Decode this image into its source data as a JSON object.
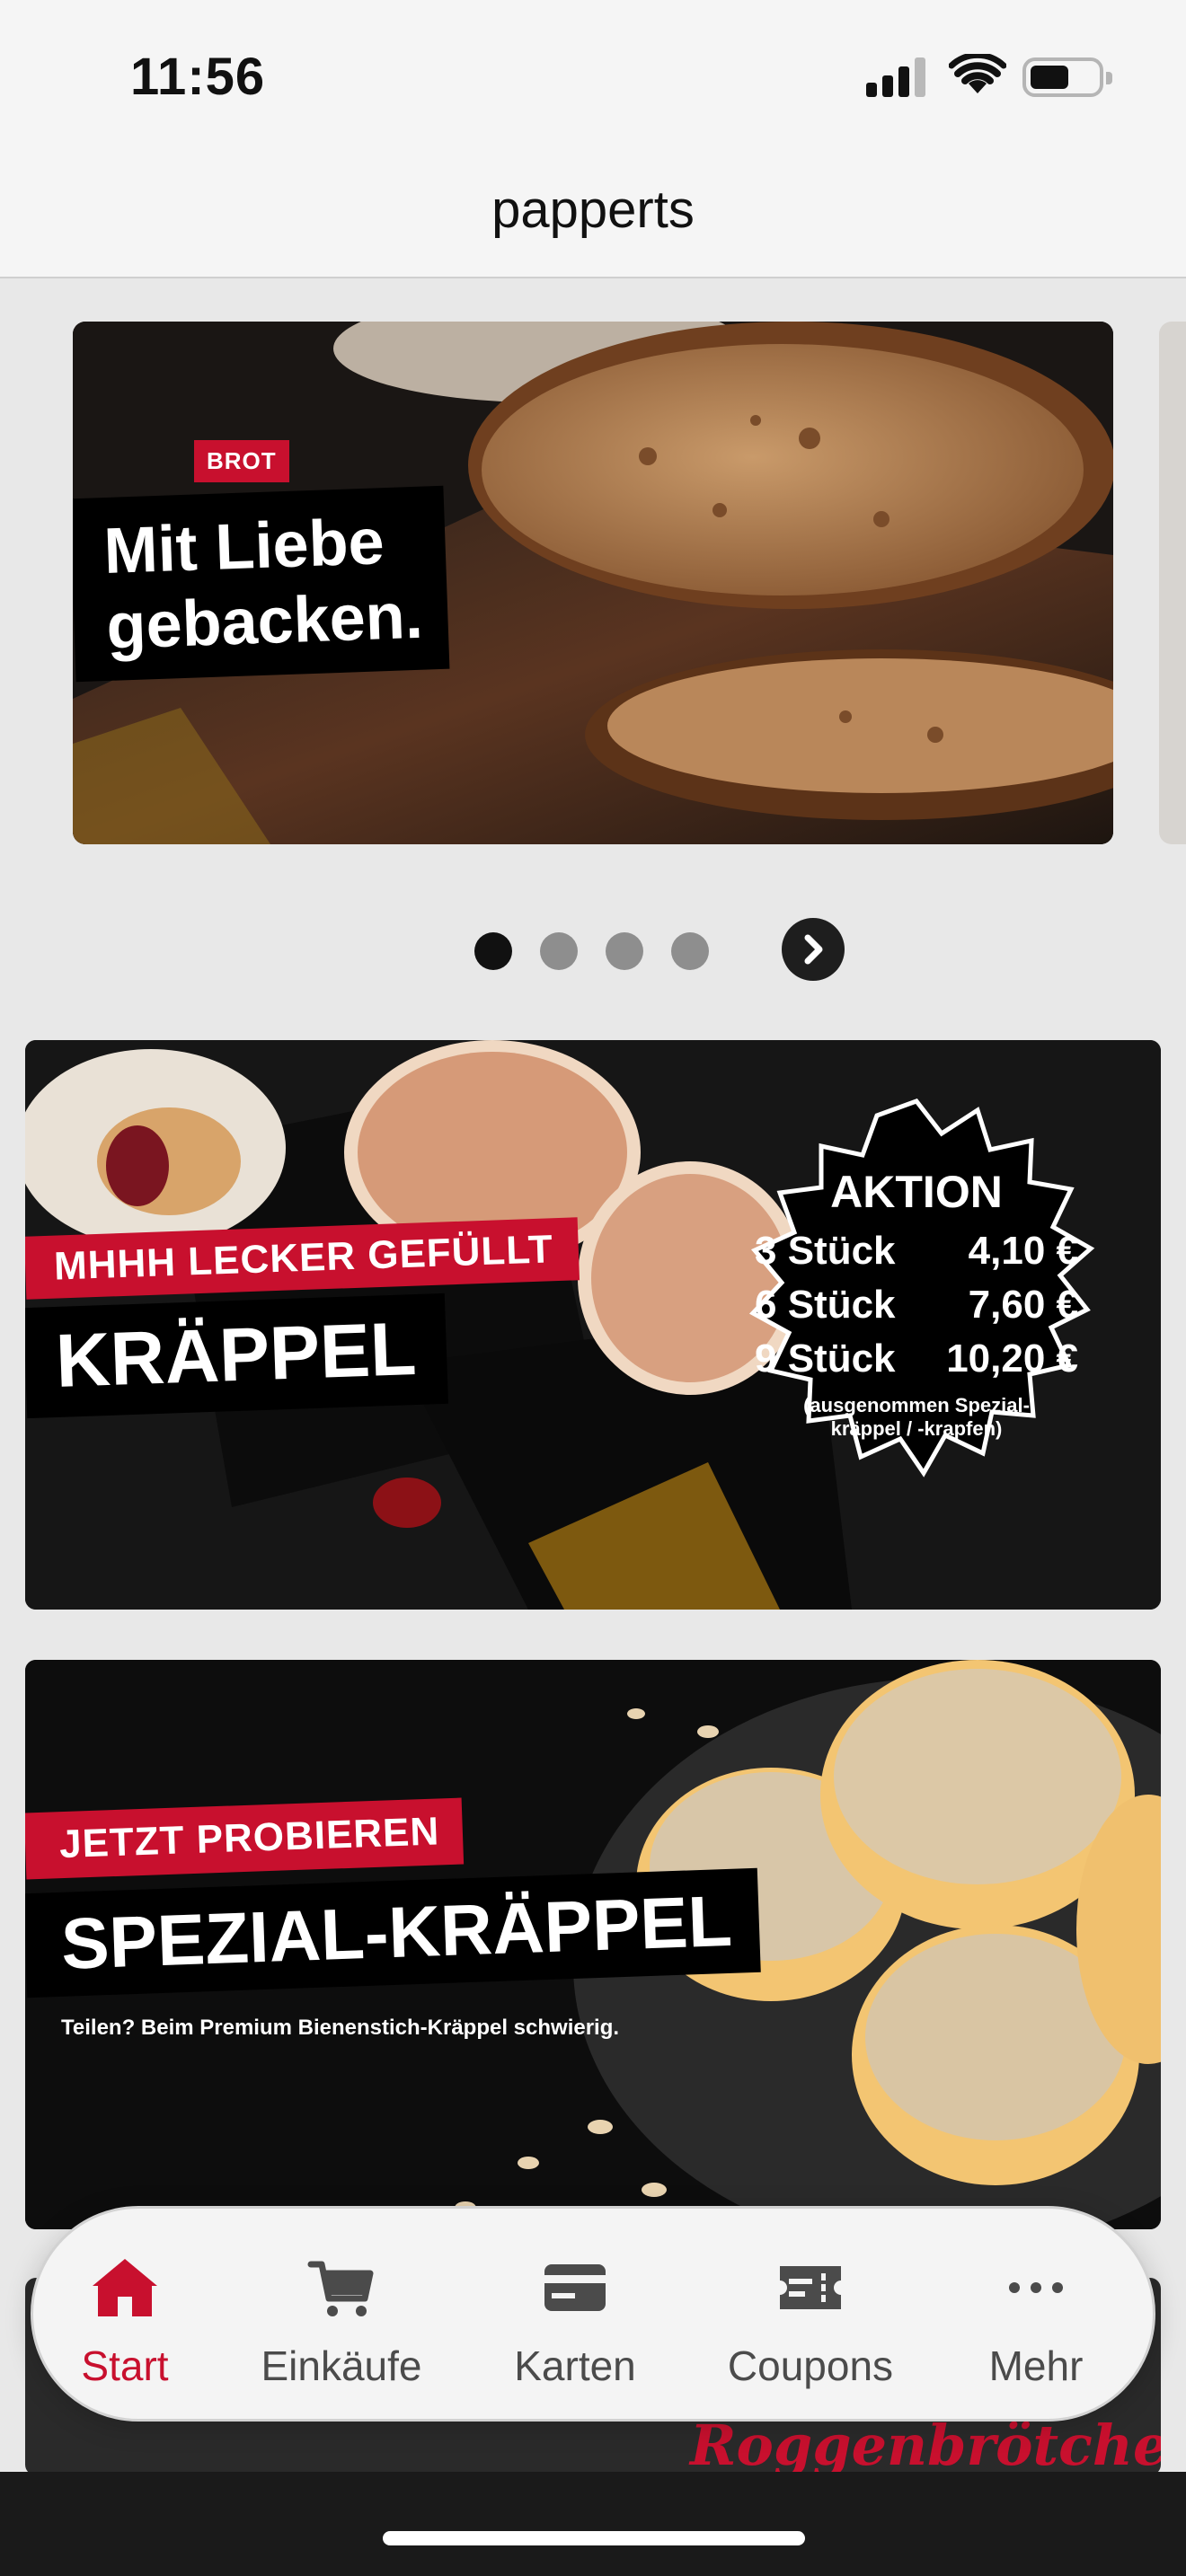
{
  "status_bar": {
    "time": "11:56"
  },
  "nav": {
    "title": "papperts"
  },
  "carousel": {
    "slide": {
      "tag": "BROT",
      "headline_line1": "Mit Liebe",
      "headline_line2": "gebacken."
    },
    "dots_count": 4,
    "active_index": 0
  },
  "promo_1": {
    "tag": "MHHH LECKER GEFÜLLT",
    "headline": "KRÄPPEL",
    "badge": {
      "title": "AKTION",
      "rows": [
        {
          "qty": "3 Stück",
          "price": "4,10 €"
        },
        {
          "qty": "6 Stück",
          "price": "7,60 €"
        },
        {
          "qty": "9 Stück",
          "price": "10,20 €"
        }
      ],
      "note_line1": "(ausgenommen Spezial-",
      "note_line2": "kräppel / -krapfen)"
    }
  },
  "promo_2": {
    "tag": "JETZT PROBIEREN",
    "headline": "SPEZIAL-KRÄPPEL",
    "subline": "Teilen? Beim Premium Bienenstich-Kräppel schwierig."
  },
  "promo_3_peek": {
    "text": "Roggenbrötchen"
  },
  "tabs": [
    {
      "label": "Start",
      "icon": "home-icon"
    },
    {
      "label": "Einkäufe",
      "icon": "cart-icon"
    },
    {
      "label": "Karten",
      "icon": "card-icon"
    },
    {
      "label": "Coupons",
      "icon": "coupon-icon"
    },
    {
      "label": "Mehr",
      "icon": "more-icon"
    }
  ],
  "colors": {
    "brand_red": "#c8102e",
    "tab_inactive": "#4b4b4b"
  }
}
